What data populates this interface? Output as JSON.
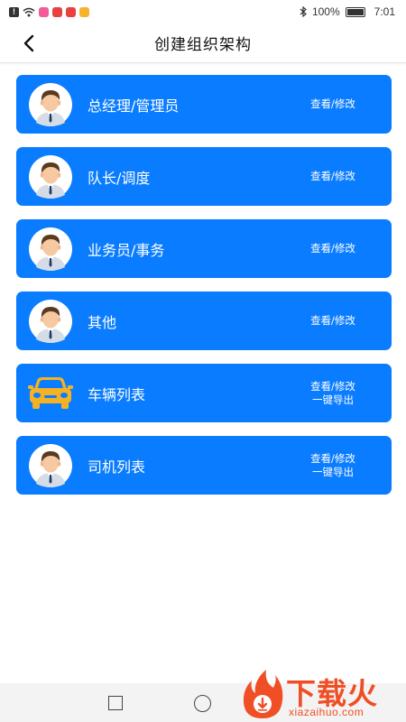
{
  "status": {
    "battery_text": "100%",
    "time": "7:01"
  },
  "header": {
    "title": "创建组织架构"
  },
  "cards": [
    {
      "label": "总经理/管理员",
      "icon": "person-avatar-icon",
      "actions": [
        "查看/修改"
      ]
    },
    {
      "label": "队长/调度",
      "icon": "person-avatar-icon",
      "actions": [
        "查看/修改"
      ]
    },
    {
      "label": "业务员/事务",
      "icon": "person-avatar-icon",
      "actions": [
        "查看/修改"
      ]
    },
    {
      "label": "其他",
      "icon": "person-avatar-icon",
      "actions": [
        "查看/修改"
      ]
    },
    {
      "label": "车辆列表",
      "icon": "car-icon",
      "actions": [
        "查看/修改",
        "一键导出"
      ]
    },
    {
      "label": "司机列表",
      "icon": "person-avatar-icon",
      "actions": [
        "查看/修改",
        "一键导出"
      ]
    }
  ],
  "watermark": {
    "brand": "下载火",
    "url": "xiazaihuo.com"
  },
  "colors": {
    "card_bg": "#0a7cff",
    "car_yellow": "#f4b224",
    "watermark": "#f04e24"
  }
}
